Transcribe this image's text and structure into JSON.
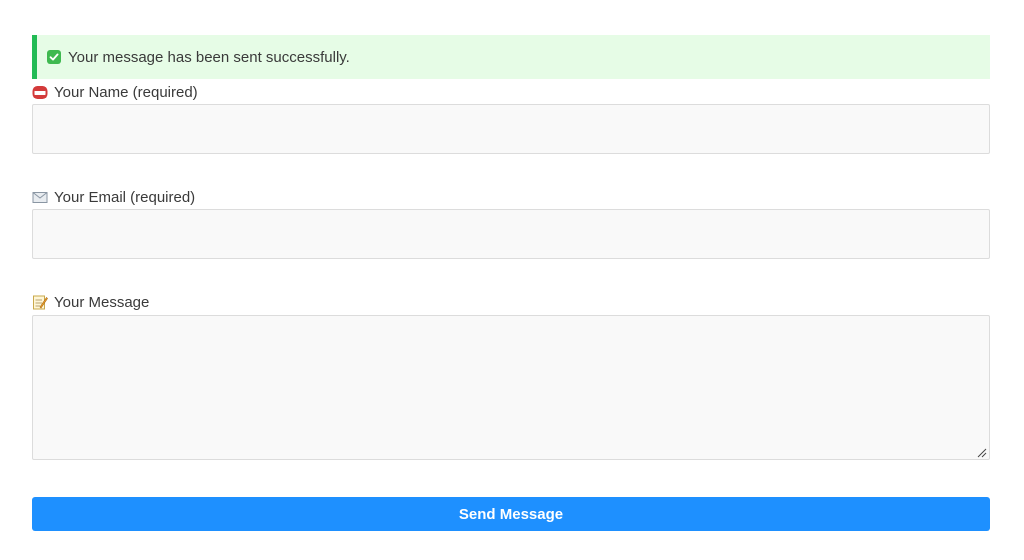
{
  "alert": {
    "message": "Your message has been sent successfully.",
    "icon": "check-mark-icon",
    "accent_color": "#22bb55",
    "background_color": "#e6fce6"
  },
  "form": {
    "name": {
      "label": "Your Name (required)",
      "icon": "name-badge-icon",
      "value": "",
      "placeholder": ""
    },
    "email": {
      "label": "Your Email (required)",
      "icon": "envelope-icon",
      "value": "",
      "placeholder": ""
    },
    "message": {
      "label": "Your Message",
      "icon": "memo-icon",
      "value": "",
      "placeholder": ""
    },
    "submit_label": "Send Message",
    "submit_color": "#1e90ff"
  }
}
